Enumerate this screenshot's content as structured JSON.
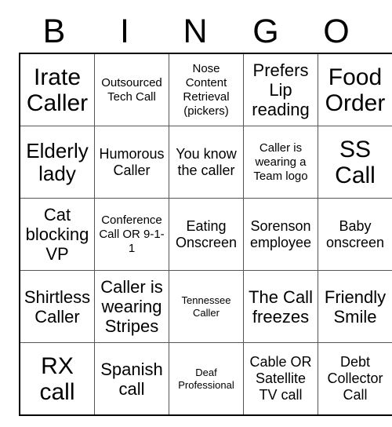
{
  "header": {
    "letters": [
      "B",
      "I",
      "N",
      "G",
      "O"
    ]
  },
  "grid": {
    "rows": [
      [
        {
          "text": "Irate Caller",
          "size": "fs-xl"
        },
        {
          "text": "Outsourced Tech Call",
          "size": "fs-xs"
        },
        {
          "text": "Nose Content Retrieval (pickers)",
          "size": "fs-xs"
        },
        {
          "text": "Prefers Lip reading",
          "size": "fs-md"
        },
        {
          "text": "Food Order",
          "size": "fs-xl"
        }
      ],
      [
        {
          "text": "Elderly lady",
          "size": "fs-lg"
        },
        {
          "text": "Humorous Caller",
          "size": "fs-sm"
        },
        {
          "text": "You know the caller",
          "size": "fs-sm"
        },
        {
          "text": "Caller is wearing a Team logo",
          "size": "fs-xs"
        },
        {
          "text": "SS Call",
          "size": "fs-xl"
        }
      ],
      [
        {
          "text": "Cat blocking VP",
          "size": "fs-md"
        },
        {
          "text": "Conference Call OR 9-1-1",
          "size": "fs-xs"
        },
        {
          "text": "Eating Onscreen",
          "size": "fs-sm"
        },
        {
          "text": "Sorenson employee",
          "size": "fs-sm"
        },
        {
          "text": "Baby onscreen",
          "size": "fs-sm"
        }
      ],
      [
        {
          "text": "Shirtless Caller",
          "size": "fs-md"
        },
        {
          "text": "Caller is wearing Stripes",
          "size": "fs-md"
        },
        {
          "text": "Tennessee Caller",
          "size": "fs-xxs"
        },
        {
          "text": "The Call freezes",
          "size": "fs-md"
        },
        {
          "text": "Friendly Smile",
          "size": "fs-md"
        }
      ],
      [
        {
          "text": "RX call",
          "size": "fs-xl"
        },
        {
          "text": "Spanish call",
          "size": "fs-md"
        },
        {
          "text": "Deaf Professional",
          "size": "fs-xxs"
        },
        {
          "text": "Cable OR Satellite TV call",
          "size": "fs-sm"
        },
        {
          "text": "Debt Collector Call",
          "size": "fs-sm"
        }
      ]
    ]
  }
}
